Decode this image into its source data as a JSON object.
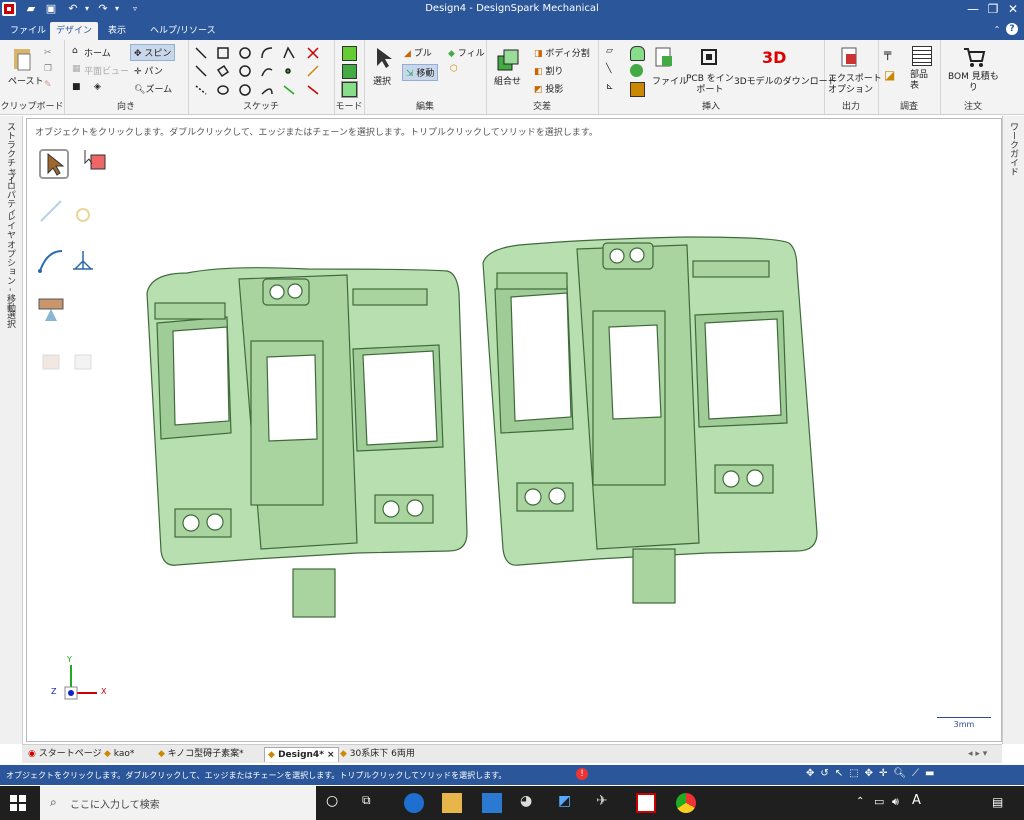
{
  "window": {
    "title": "Design4 - DesignSpark Mechanical",
    "controls": {
      "minimize": "—",
      "maximize": "❐",
      "close": "✕"
    }
  },
  "menu_tabs": [
    {
      "label": "ファイル"
    },
    {
      "label": "デザイン",
      "active": true
    },
    {
      "label": "表示"
    },
    {
      "label": "ヘルプ/リソース"
    }
  ],
  "ribbon": {
    "clipboard": {
      "paste": "ペースト",
      "group": "クリップボード"
    },
    "orient": {
      "home": "ホーム",
      "plan_view": "平面ビュー",
      "spin": "スピン",
      "pan": "パン",
      "zoom": "ズーム",
      "group": "向き"
    },
    "sketch": {
      "group": "スケッチ"
    },
    "mode": {
      "group": "モード"
    },
    "edit": {
      "select": "選択",
      "pull": "プル",
      "move": "移動",
      "fill": "フィル",
      "group": "編集"
    },
    "intersect": {
      "combine": "組合せ",
      "split_body": "ボディ分割",
      "split": "割り",
      "project": "投影",
      "group": "交差"
    },
    "insert": {
      "file": "ファイル",
      "pcb": "PCB をイン\nポート",
      "download_3d": "3Dモデルのダウンロード",
      "group": "挿入"
    },
    "output": {
      "export": "エクスポート\nオプション",
      "group": "出力"
    },
    "investigate": {
      "parts_table": "部品\n表",
      "group": "調査"
    },
    "order": {
      "bom": "BOM 見積も\nり",
      "group": "注文"
    }
  },
  "left_panel_tabs": [
    "ストラクチャー",
    "プロパティ",
    "レイヤ",
    "オプション - 移動",
    "選択"
  ],
  "right_panel_tabs": [
    "ワークガイド"
  ],
  "canvas": {
    "hint": "オブジェクトをクリックします。ダブルクリックして、エッジまたはチェーンを選択します。トリプルクリックしてソリッドを選択します。",
    "scale_label": "3mm",
    "triad": {
      "y": "Y",
      "x": "X",
      "z": "Z"
    },
    "model_color": "#b8dfb0"
  },
  "doc_tabs": [
    {
      "label": "スタートページ"
    },
    {
      "label": "kao*"
    },
    {
      "label": "キノコ型碍子素案*"
    },
    {
      "label": "Design4*",
      "active": true,
      "close": "×"
    },
    {
      "label": "30系床下 6両用"
    }
  ],
  "statusbar": {
    "message": "オブジェクトをクリックします。ダブルクリックして、エッジまたはチェーンを選択します。トリプルクリックしてソリッドを選択します。"
  },
  "taskbar": {
    "search_placeholder": "ここに入力して検索",
    "ime": "A"
  }
}
